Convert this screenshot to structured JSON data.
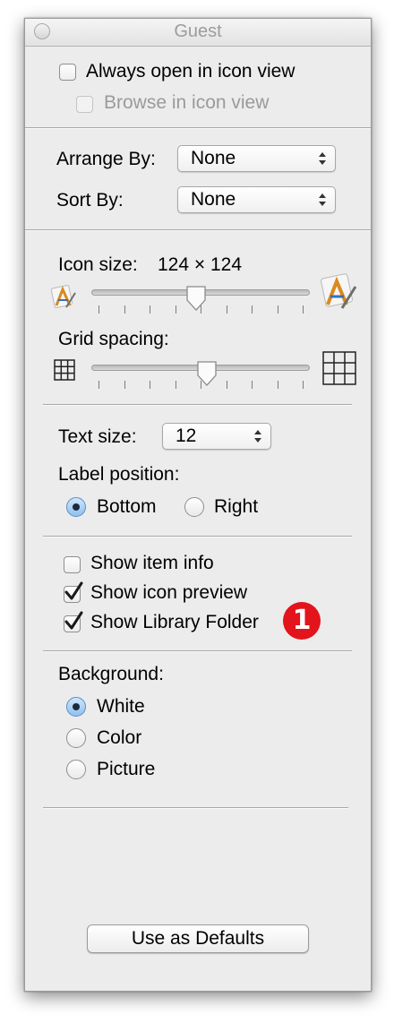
{
  "window": {
    "title": "Guest"
  },
  "view": {
    "always_open_icon_view": {
      "label": "Always open in icon view",
      "checked": false
    },
    "browse_icon_view": {
      "label": "Browse in icon view",
      "checked": false,
      "enabled": false
    }
  },
  "arrange": {
    "arrange_by_label": "Arrange By:",
    "arrange_by_value": "None",
    "sort_by_label": "Sort By:",
    "sort_by_value": "None"
  },
  "icon_size": {
    "label": "Icon size:",
    "value": "124 × 124",
    "slider_fraction": 0.48
  },
  "grid_spacing": {
    "label": "Grid spacing:",
    "slider_fraction": 0.53
  },
  "text": {
    "text_size_label": "Text size:",
    "text_size_value": "12",
    "label_position_label": "Label position:",
    "options": [
      {
        "label": "Bottom",
        "selected": true
      },
      {
        "label": "Right",
        "selected": false
      }
    ]
  },
  "show": [
    {
      "label": "Show item info",
      "checked": false
    },
    {
      "label": "Show icon preview",
      "checked": true
    },
    {
      "label": "Show Library Folder",
      "checked": true
    }
  ],
  "callout": {
    "number": "1",
    "color": "#e3141b"
  },
  "background": {
    "label": "Background:",
    "options": [
      {
        "label": "White",
        "selected": true
      },
      {
        "label": "Color",
        "selected": false
      },
      {
        "label": "Picture",
        "selected": false
      }
    ]
  },
  "defaults_button": {
    "label": "Use as Defaults"
  }
}
